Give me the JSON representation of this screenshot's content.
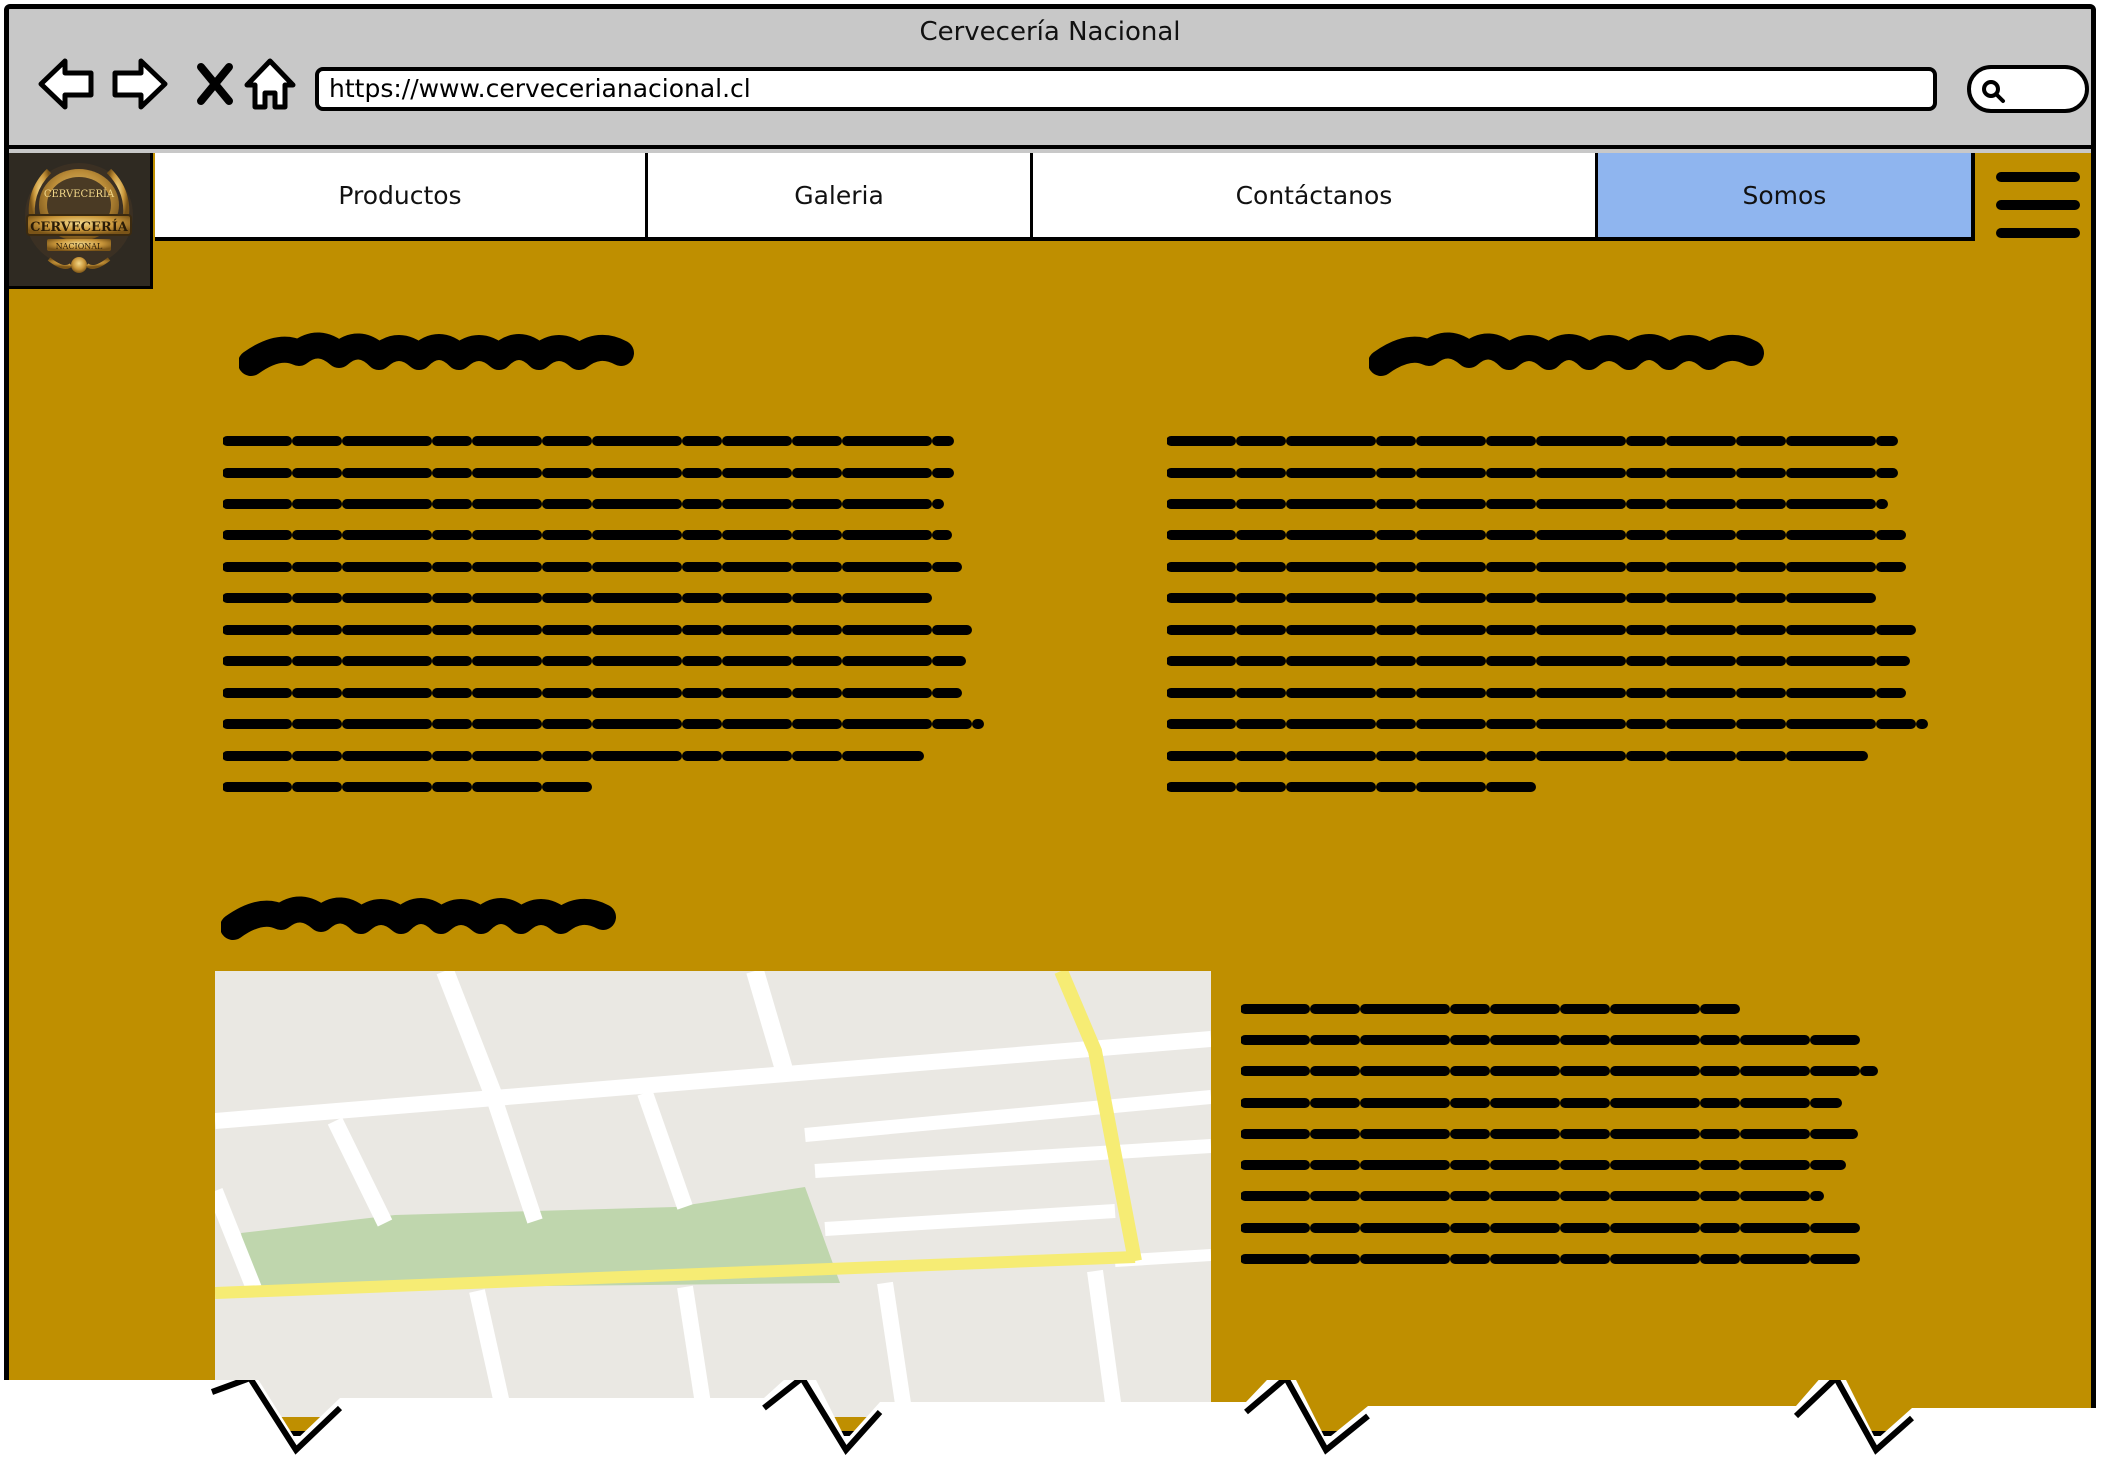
{
  "window": {
    "title": "Cervecería Nacional",
    "url": "https://www.cervecerianacional.cl"
  },
  "toolbar": {
    "icons": [
      "back-arrow-icon",
      "forward-arrow-icon",
      "close-x-icon",
      "home-icon",
      "search-icon"
    ]
  },
  "logo": {
    "text_top": "CERVECERÍA",
    "text_mid": "CERVECERÍA",
    "text_bottom": "NACIONAL"
  },
  "nav": {
    "items": [
      {
        "label": "Productos",
        "active": false
      },
      {
        "label": "Galeria",
        "active": false
      },
      {
        "label": "Contáctanos",
        "active": false
      },
      {
        "label": "Somos",
        "active": true
      }
    ],
    "menu_icon": "hamburger-menu-icon"
  },
  "colors": {
    "page_background": "#bf8f00",
    "active_tab": "#8fb5ef",
    "browser_chrome": "#c8c8c8",
    "map_park": "#bfd6ad",
    "map_highway": "#f6ec74"
  }
}
